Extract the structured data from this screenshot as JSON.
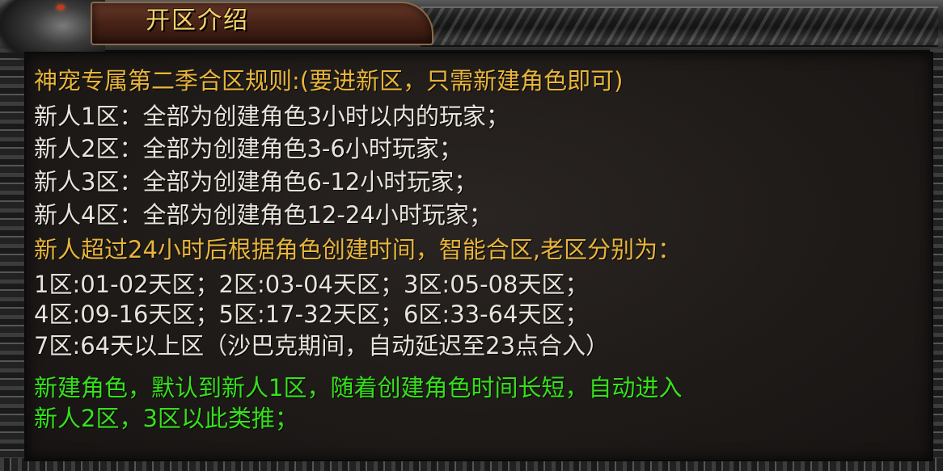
{
  "panel": {
    "title": "开区介绍",
    "colors": {
      "gold": "#e8b53c",
      "white": "#e8e4dc",
      "green": "#36e01c",
      "title": "#f2d46a"
    }
  },
  "lines": [
    {
      "text": "神宠专属第二季合区规则:(要进新区，只需新建角色即可)",
      "color": "gold"
    },
    {
      "text": "新人1区：全部为创建角色3小时以内的玩家；",
      "color": "white"
    },
    {
      "text": "新人2区：全部为创建角色3-6小时玩家；",
      "color": "white"
    },
    {
      "text": "新人3区：全部为创建角色6-12小时玩家；",
      "color": "white"
    },
    {
      "text": "新人4区：全部为创建角色12-24小时玩家；",
      "color": "white"
    },
    {
      "text": "新人超过24小时后根据角色创建时间，智能合区,老区分别为：",
      "color": "gold"
    },
    {
      "text": "1区:01-02天区；2区:03-04天区；3区:05-08天区；",
      "color": "white"
    },
    {
      "text": "4区:09-16天区；5区:17-32天区；6区:33-64天区；",
      "color": "white"
    },
    {
      "text": "7区:64天以上区（沙巴克期间，自动延迟至23点合入）",
      "color": "white"
    },
    {
      "text": "新建角色，默认到新人1区，随着创建角色时间长短，自动进入",
      "color": "green"
    },
    {
      "text": "新人2区，3区以此类推；",
      "color": "green"
    }
  ]
}
